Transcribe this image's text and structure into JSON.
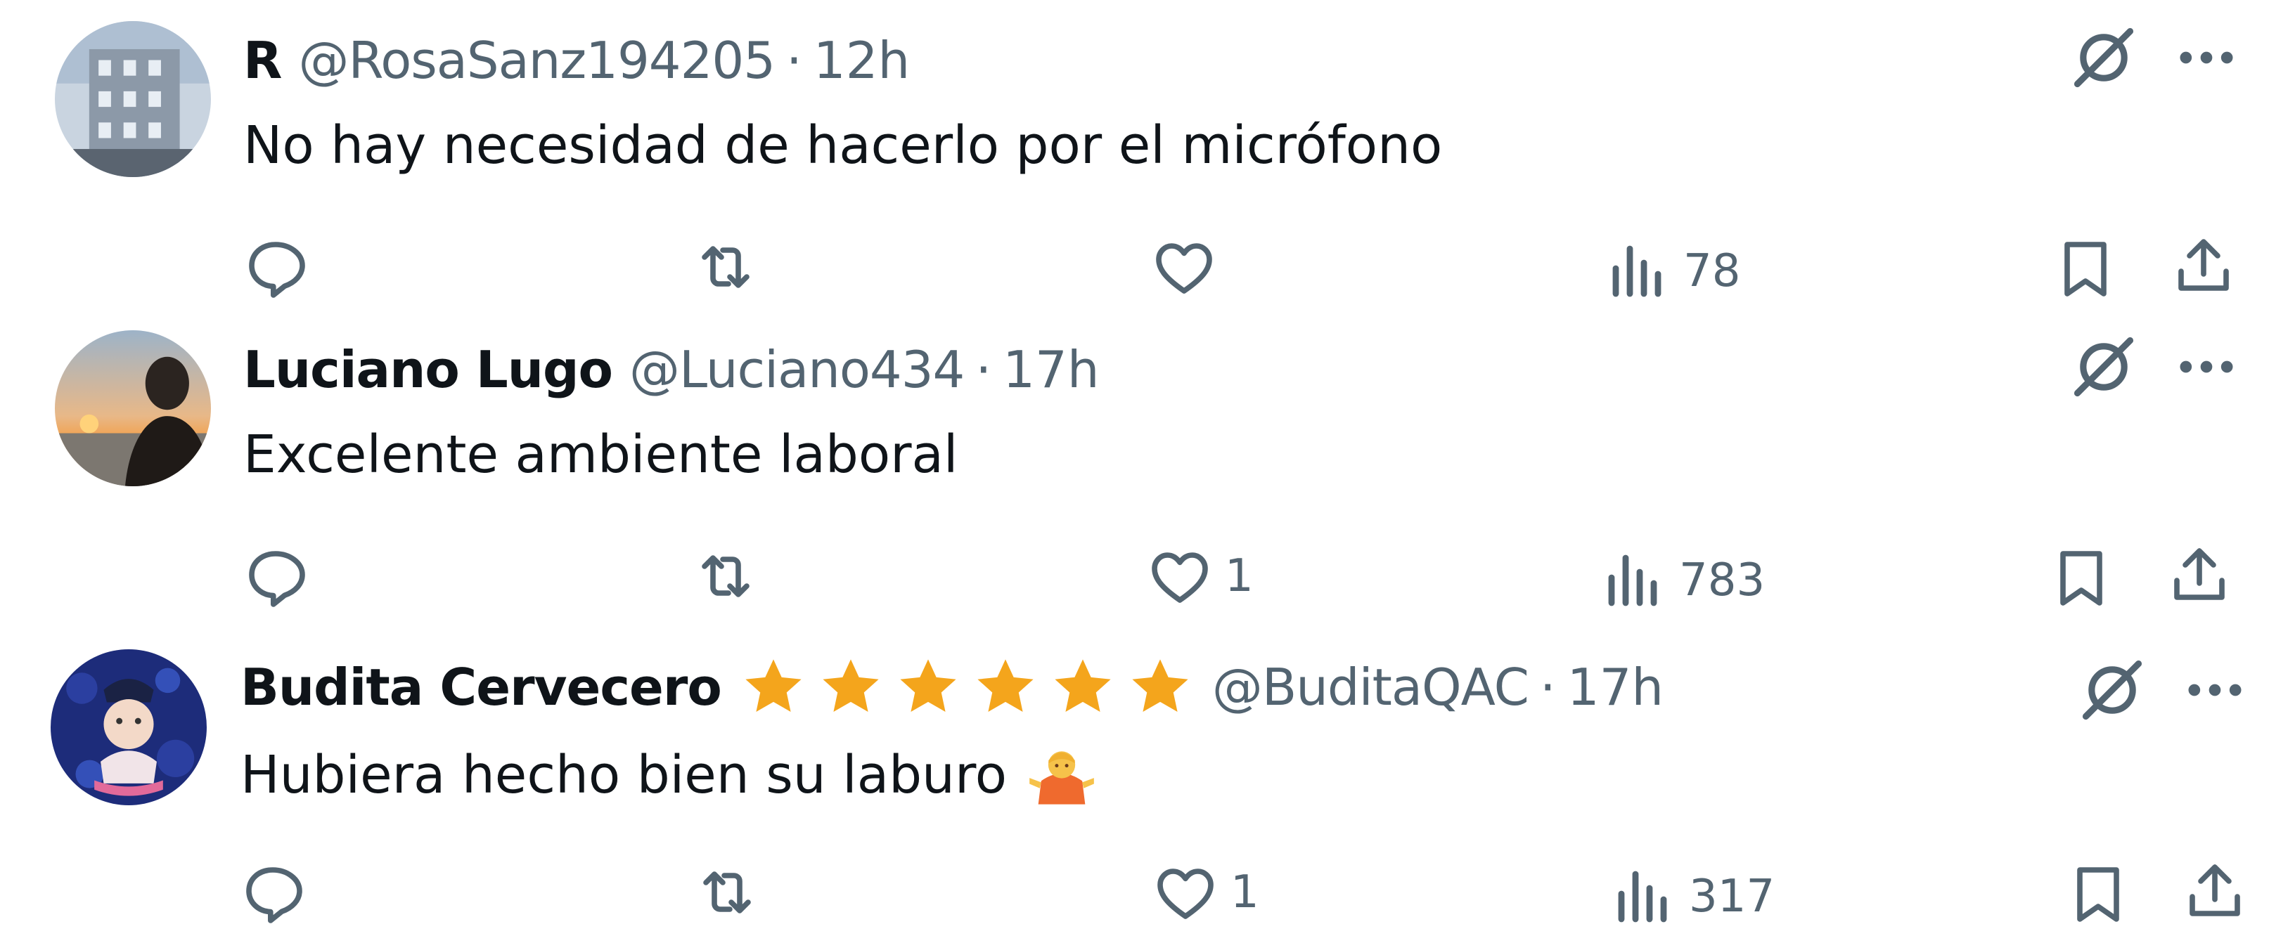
{
  "tweets": [
    {
      "name": "R",
      "handle": "@RosaSanz194205",
      "separator": "·",
      "time": "12h",
      "text": "No hay necesidad de hacerlo por el micrófono",
      "verified_stars": 0,
      "emoji": "",
      "metrics": {
        "replies": "",
        "reposts": "",
        "likes": "",
        "views": "78"
      }
    },
    {
      "name": "Luciano Lugo",
      "handle": "@Luciano434",
      "separator": "·",
      "time": "17h",
      "text": "Excelente ambiente laboral",
      "verified_stars": 0,
      "emoji": "",
      "metrics": {
        "replies": "",
        "reposts": "",
        "likes": "1",
        "views": "783"
      }
    },
    {
      "name": "Budita Cervecero",
      "handle": "@BuditaQAC",
      "separator": "·",
      "time": "17h",
      "text": "Hubiera hecho bien su laburo",
      "verified_stars": 6,
      "emoji": "person-shrugging-emoji",
      "metrics": {
        "replies": "",
        "reposts": "",
        "likes": "1",
        "views": "317"
      }
    }
  ],
  "icons": {
    "grok": "grok-icon",
    "more": "more-options-icon",
    "reply": "reply-icon",
    "repost": "repost-icon",
    "like": "like-icon",
    "views": "views-icon",
    "bookmark": "bookmark-icon",
    "share": "share-icon",
    "star": "star-icon"
  },
  "colors": {
    "text_primary": "#0f1419",
    "text_secondary": "#536471",
    "star": "#f4a51c"
  }
}
